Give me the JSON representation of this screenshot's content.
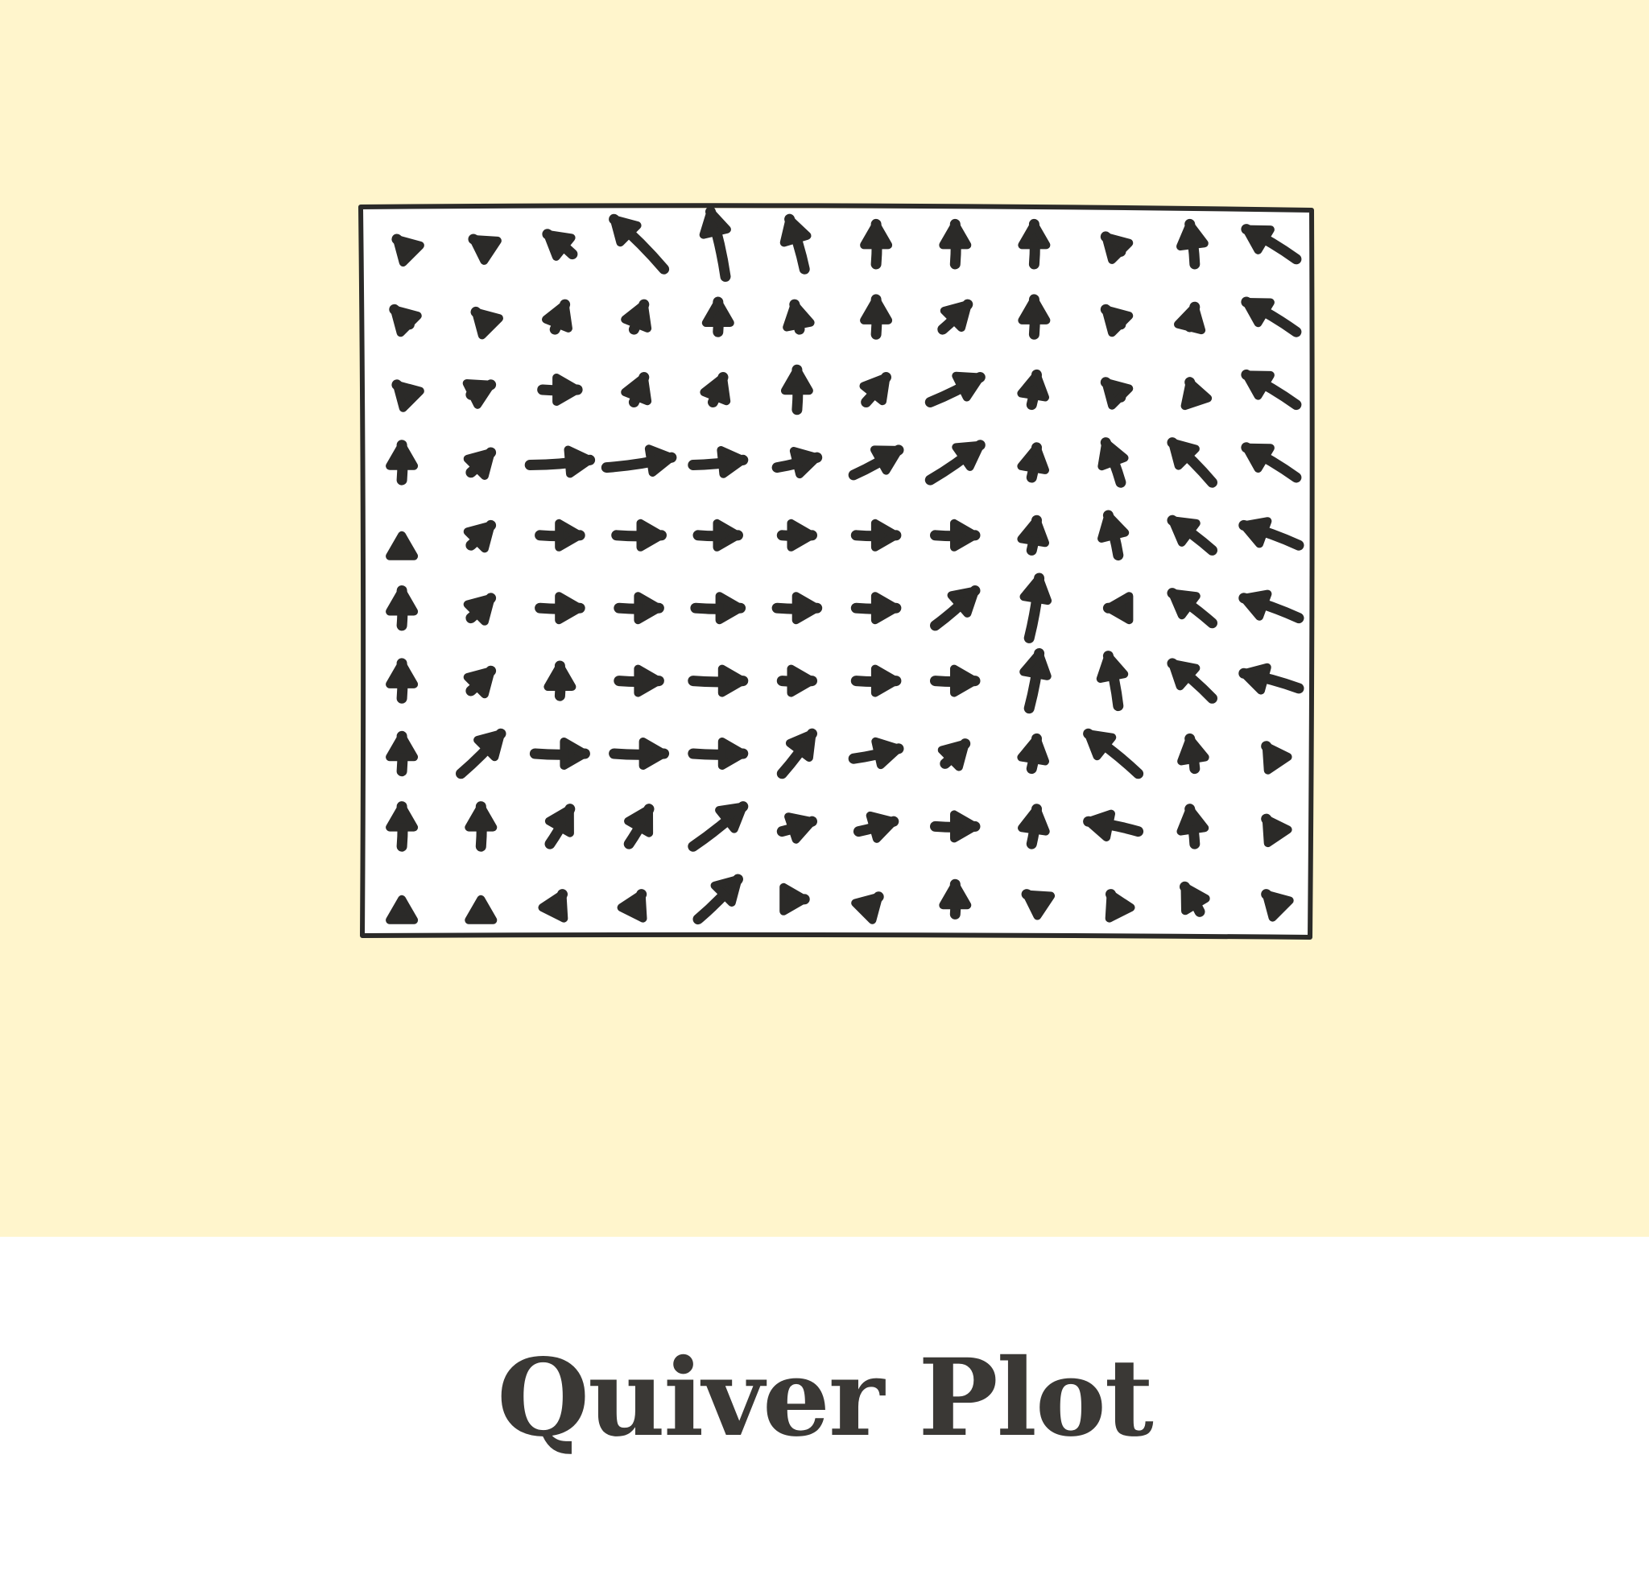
{
  "caption": {
    "title": "Quiver Plot"
  },
  "colors": {
    "panel_background": "#fff5cc",
    "plot_background": "#ffffff",
    "ink": "#2b2a28",
    "title_text": "#3a3835"
  },
  "chart_data": {
    "type": "quiver",
    "grid": false,
    "style": "hand-drawn",
    "xlim": [
      0,
      12
    ],
    "ylim": [
      0,
      10
    ],
    "rows": [
      {
        "y": 9.5,
        "u": [
          -0.2,
          -0.3,
          -0.5,
          -1.0,
          -0.3,
          -0.3,
          0.0,
          0.0,
          0.0,
          -0.3,
          -0.1,
          -1.0
        ]
      },
      {
        "y": 8.5,
        "u": [
          -0.3,
          -0.2,
          0.2,
          0.2,
          0.0,
          -0.1,
          0.0,
          0.5,
          0.0,
          -0.3,
          0.1,
          -1.0
        ]
      },
      {
        "y": 7.5,
        "u": [
          -0.2,
          0.4,
          0.7,
          0.2,
          0.2,
          0.0,
          0.4,
          1.0,
          0.1,
          -0.3,
          -0.1,
          -1.0
        ]
      },
      {
        "y": 6.5,
        "u": [
          0.0,
          0.4,
          1.2,
          1.3,
          1.0,
          0.8,
          0.9,
          1.0,
          0.1,
          -0.3,
          -0.8,
          -1.0
        ]
      },
      {
        "y": 5.5,
        "u": [
          0.0,
          0.4,
          0.8,
          0.9,
          0.8,
          0.6,
          0.8,
          0.8,
          0.1,
          -0.2,
          -0.8,
          -1.1
        ]
      },
      {
        "y": 4.5,
        "u": [
          0.0,
          0.4,
          0.8,
          0.8,
          0.9,
          0.8,
          0.8,
          0.8,
          0.2,
          -0.2,
          -0.8,
          -1.1
        ]
      },
      {
        "y": 3.5,
        "u": [
          0.0,
          0.4,
          0.0,
          0.8,
          1.0,
          0.6,
          0.8,
          0.8,
          0.2,
          -0.2,
          -0.8,
          -1.1
        ]
      },
      {
        "y": 2.5,
        "u": [
          0.0,
          0.8,
          1.0,
          1.0,
          1.0,
          0.6,
          0.9,
          0.4,
          0.1,
          -1.0,
          -0.1,
          -0.2
        ]
      },
      {
        "y": 1.5,
        "u": [
          0.0,
          0.0,
          0.4,
          0.4,
          1.0,
          0.6,
          0.7,
          0.8,
          0.1,
          -1.0,
          -0.1,
          -0.2
        ]
      },
      {
        "y": 0.5,
        "u": [
          0.0,
          0.0,
          0.1,
          0.1,
          0.8,
          0.3,
          0.1,
          0.0,
          -0.3,
          -0.1,
          -0.3,
          -0.2
        ]
      }
    ],
    "v": [
      [
        0.2,
        0.2,
        0.4,
        1.0,
        1.3,
        1.0,
        0.8,
        0.8,
        0.8,
        0.3,
        0.8,
        0.6
      ],
      [
        0.3,
        0.2,
        0.5,
        0.5,
        0.6,
        0.5,
        0.7,
        0.5,
        0.7,
        0.3,
        0.4,
        0.6
      ],
      [
        0.2,
        0.2,
        0.0,
        0.5,
        0.5,
        0.8,
        0.5,
        0.5,
        0.6,
        0.3,
        0.3,
        0.6
      ],
      [
        0.7,
        0.4,
        0.1,
        0.2,
        0.1,
        0.2,
        0.5,
        0.7,
        0.6,
        0.8,
        0.8,
        0.6
      ],
      [
        0.0,
        0.4,
        0.0,
        0.0,
        0.0,
        0.0,
        0.0,
        0.0,
        0.6,
        0.8,
        0.6,
        0.4
      ],
      [
        0.7,
        0.4,
        0.0,
        0.0,
        0.0,
        0.0,
        0.0,
        0.7,
        1.2,
        0.0,
        0.6,
        0.4
      ],
      [
        0.7,
        0.4,
        0.6,
        0.0,
        0.0,
        0.0,
        0.0,
        0.0,
        1.1,
        1.0,
        0.7,
        0.3
      ],
      [
        0.7,
        0.8,
        0.0,
        0.0,
        0.0,
        0.8,
        0.2,
        0.4,
        0.6,
        0.8,
        0.6,
        0.3
      ],
      [
        0.8,
        0.8,
        0.7,
        0.7,
        0.8,
        0.2,
        0.2,
        0.0,
        0.7,
        0.2,
        0.7,
        0.3
      ],
      [
        0.0,
        0.0,
        0.2,
        0.2,
        0.8,
        0.0,
        0.1,
        0.6,
        0.2,
        0.2,
        0.5,
        0.2
      ]
    ],
    "x": [
      0.5,
      1.5,
      2.5,
      3.5,
      4.5,
      5.5,
      6.5,
      7.5,
      8.5,
      9.5,
      10.5,
      11.5
    ]
  }
}
